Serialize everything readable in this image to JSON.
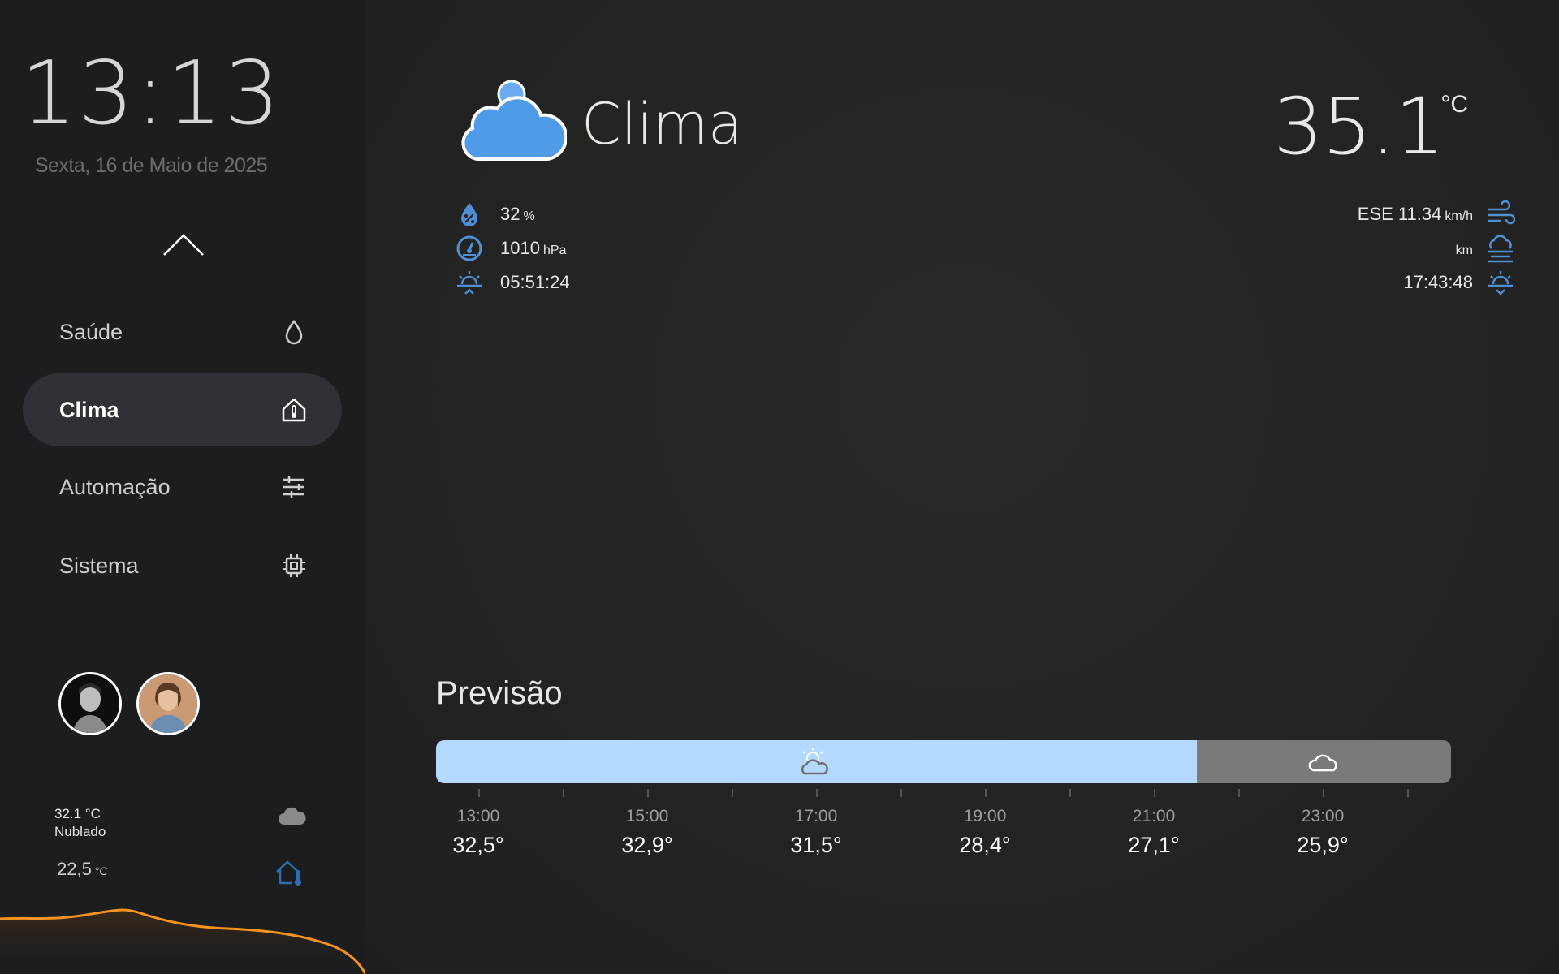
{
  "sidebar": {
    "clock": "13:13",
    "date": "Sexta, 16 de Maio de 2025",
    "nav": [
      {
        "label": "Saúde",
        "icon": "water-drop-icon"
      },
      {
        "label": "Clima",
        "icon": "home-thermometer-icon",
        "active": true
      },
      {
        "label": "Automação",
        "icon": "sliders-icon"
      },
      {
        "label": "Sistema",
        "icon": "chip-icon"
      }
    ],
    "mini_weather": {
      "temp": "32.1 °C",
      "condition": "Nublado",
      "icon": "cloud-icon"
    },
    "indoor": {
      "value": "22,5",
      "unit": "°C",
      "icon": "home-thermometer-icon"
    },
    "accent_color": "#f7931e"
  },
  "main": {
    "title": "Clima",
    "temperature": "35.1",
    "temperature_unit": "°C",
    "humidity": {
      "value": "32",
      "unit": "%"
    },
    "pressure": {
      "value": "1010",
      "unit": "hPa"
    },
    "sunrise": "05:51:24",
    "wind": {
      "value": "ESE 11.34",
      "unit": "km/h"
    },
    "visibility": {
      "value": "",
      "unit": "km"
    },
    "sunset": "17:43:48",
    "icon_color": "#4f8fd4"
  },
  "forecast": {
    "title": "Previsão",
    "segments": [
      {
        "condition": "partly-cloudy",
        "icon": "sun-cloud-icon",
        "color": "#b3d9ff",
        "fraction": 0.75
      },
      {
        "condition": "cloudy",
        "icon": "cloud-icon",
        "color": "#7a7a7a",
        "fraction": 0.25
      }
    ],
    "hours": [
      {
        "time": "13:00",
        "temp": "32,5°"
      },
      {
        "time": "15:00",
        "temp": "32,9°"
      },
      {
        "time": "17:00",
        "temp": "31,5°"
      },
      {
        "time": "19:00",
        "temp": "28,4°"
      },
      {
        "time": "21:00",
        "temp": "27,1°"
      },
      {
        "time": "23:00",
        "temp": "25,9°"
      }
    ]
  }
}
